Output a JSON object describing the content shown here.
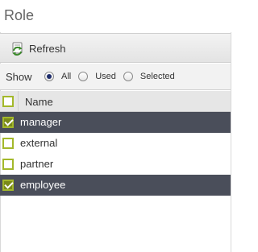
{
  "panel": {
    "title": "Role"
  },
  "toolbar": {
    "refresh_label": "Refresh"
  },
  "filter": {
    "show_label": "Show",
    "options": [
      {
        "label": "All",
        "checked": true
      },
      {
        "label": "Used",
        "checked": false
      },
      {
        "label": "Selected",
        "checked": false
      }
    ]
  },
  "grid": {
    "column_header": "Name",
    "rows": [
      {
        "label": "manager",
        "checked": true,
        "selected": true
      },
      {
        "label": "external",
        "checked": false,
        "selected": false
      },
      {
        "label": "partner",
        "checked": false,
        "selected": false
      },
      {
        "label": "employee",
        "checked": true,
        "selected": true
      }
    ]
  },
  "colors": {
    "accent_checkbox": "#a3b82a",
    "selected_row": "#4a4e5a"
  }
}
